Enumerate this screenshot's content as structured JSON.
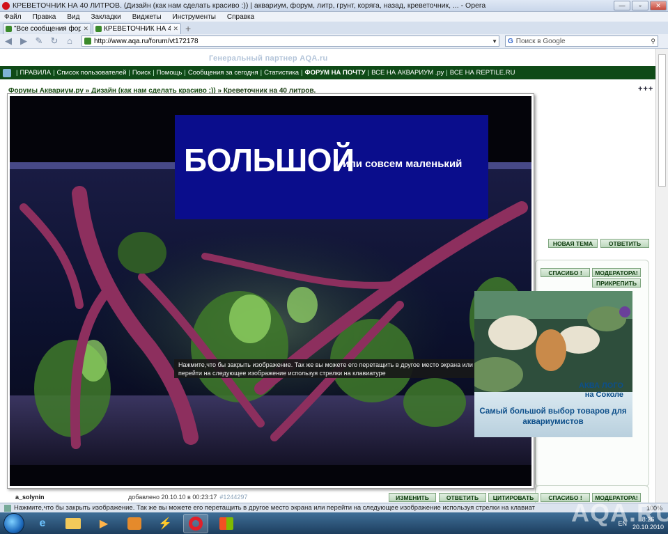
{
  "window": {
    "title": "КРЕВЕТОЧНИК НА 40 ЛИТРОВ. (Дизайн (как нам сделать красиво :)) | аквариум, форум, литр, грунт, коряга, назад, креветочник, ... - Opera"
  },
  "menu": [
    "Файл",
    "Правка",
    "Вид",
    "Закладки",
    "Виджеты",
    "Инструменты",
    "Справка"
  ],
  "tabs": [
    {
      "label": "\"Все сообщения фору..."
    },
    {
      "label": "КРЕВЕТОЧНИК НА 40 ..."
    }
  ],
  "address": {
    "url": "http://www.aqa.ru/forum/vt172178",
    "search_placeholder": "Поиск в Google"
  },
  "page": {
    "partner": "Генеральный партнер AQA.ru",
    "nav": [
      "ПРАВИЛА",
      "Список пользователей",
      "Поиск",
      "Помощь",
      "Сообщения за сегодня",
      "Статистика",
      "ФОРУМ НА ПОЧТУ",
      "ВСЕ НА АКВАРИУМ .ру",
      "ВСЕ НА REPTILE.RU"
    ],
    "breadcrumb": {
      "root": "Форумы Аквариум.ру",
      "sep": " » ",
      "section": "Дизайн (как нам сделать красиво ;))",
      "current": "Креветочник на 40 литров."
    },
    "dots": "+++",
    "buttons": {
      "new_topic": "НОВАЯ ТЕМА",
      "reply": "ОТВЕТИТЬ",
      "thanks": "СПАСИБО !",
      "moderators": "МОДЕРАТОРА!",
      "pin": "ПРИКРЕПИТЬ",
      "edit": "ИЗМЕНИТЬ",
      "answer": "ОТВЕТИТЬ",
      "quote": "ЦИТИРОВАТЬ",
      "thanks2": "СПАСИБО !",
      "moderators2": "МОДЕРАТОРА!"
    },
    "post": {
      "author": "a_solynin",
      "added": "добавлено 20.10.10 в 00:23:17",
      "id": "#1244297"
    }
  },
  "lightbox": {
    "banner_big": "БОЛЬШОЙ",
    "banner_small": "или совсем маленький",
    "tooltip": "Нажмите,что бы закрыть изображение. Так же вы можете его перетащить в другое место экрана или перейти на следующее изображение используя стрелки на клавиатуре"
  },
  "ad": {
    "brand_line1": "АКВА ЛОГО",
    "brand_line2": "на Соколе",
    "slogan": "Самый большой выбор товаров для аквариумистов"
  },
  "status": {
    "text": "Нажмите,что бы закрыть изображение. Так же вы можете его перетащить в другое место экрана или перейти на следующее изображение используя стрелки на клавиат",
    "zoom": "100%"
  },
  "taskbar": {
    "lang": "EN",
    "time": "8:26",
    "date": "20.10.2010"
  },
  "watermark": "AQA.RU",
  "colors": {
    "nav_green": "#0f4a17",
    "banner_blue": "#0a0d8c",
    "ad_text": "#0d4f8a"
  }
}
